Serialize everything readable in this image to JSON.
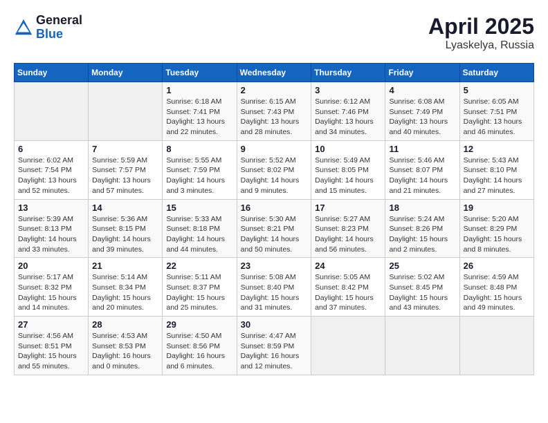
{
  "header": {
    "logo_general": "General",
    "logo_blue": "Blue",
    "month_year": "April 2025",
    "location": "Lyaskelya, Russia"
  },
  "weekdays": [
    "Sunday",
    "Monday",
    "Tuesday",
    "Wednesday",
    "Thursday",
    "Friday",
    "Saturday"
  ],
  "weeks": [
    [
      {
        "day": "",
        "info": ""
      },
      {
        "day": "",
        "info": ""
      },
      {
        "day": "1",
        "info": "Sunrise: 6:18 AM\nSunset: 7:41 PM\nDaylight: 13 hours and 22 minutes."
      },
      {
        "day": "2",
        "info": "Sunrise: 6:15 AM\nSunset: 7:43 PM\nDaylight: 13 hours and 28 minutes."
      },
      {
        "day": "3",
        "info": "Sunrise: 6:12 AM\nSunset: 7:46 PM\nDaylight: 13 hours and 34 minutes."
      },
      {
        "day": "4",
        "info": "Sunrise: 6:08 AM\nSunset: 7:49 PM\nDaylight: 13 hours and 40 minutes."
      },
      {
        "day": "5",
        "info": "Sunrise: 6:05 AM\nSunset: 7:51 PM\nDaylight: 13 hours and 46 minutes."
      }
    ],
    [
      {
        "day": "6",
        "info": "Sunrise: 6:02 AM\nSunset: 7:54 PM\nDaylight: 13 hours and 52 minutes."
      },
      {
        "day": "7",
        "info": "Sunrise: 5:59 AM\nSunset: 7:57 PM\nDaylight: 13 hours and 57 minutes."
      },
      {
        "day": "8",
        "info": "Sunrise: 5:55 AM\nSunset: 7:59 PM\nDaylight: 14 hours and 3 minutes."
      },
      {
        "day": "9",
        "info": "Sunrise: 5:52 AM\nSunset: 8:02 PM\nDaylight: 14 hours and 9 minutes."
      },
      {
        "day": "10",
        "info": "Sunrise: 5:49 AM\nSunset: 8:05 PM\nDaylight: 14 hours and 15 minutes."
      },
      {
        "day": "11",
        "info": "Sunrise: 5:46 AM\nSunset: 8:07 PM\nDaylight: 14 hours and 21 minutes."
      },
      {
        "day": "12",
        "info": "Sunrise: 5:43 AM\nSunset: 8:10 PM\nDaylight: 14 hours and 27 minutes."
      }
    ],
    [
      {
        "day": "13",
        "info": "Sunrise: 5:39 AM\nSunset: 8:13 PM\nDaylight: 14 hours and 33 minutes."
      },
      {
        "day": "14",
        "info": "Sunrise: 5:36 AM\nSunset: 8:15 PM\nDaylight: 14 hours and 39 minutes."
      },
      {
        "day": "15",
        "info": "Sunrise: 5:33 AM\nSunset: 8:18 PM\nDaylight: 14 hours and 44 minutes."
      },
      {
        "day": "16",
        "info": "Sunrise: 5:30 AM\nSunset: 8:21 PM\nDaylight: 14 hours and 50 minutes."
      },
      {
        "day": "17",
        "info": "Sunrise: 5:27 AM\nSunset: 8:23 PM\nDaylight: 14 hours and 56 minutes."
      },
      {
        "day": "18",
        "info": "Sunrise: 5:24 AM\nSunset: 8:26 PM\nDaylight: 15 hours and 2 minutes."
      },
      {
        "day": "19",
        "info": "Sunrise: 5:20 AM\nSunset: 8:29 PM\nDaylight: 15 hours and 8 minutes."
      }
    ],
    [
      {
        "day": "20",
        "info": "Sunrise: 5:17 AM\nSunset: 8:32 PM\nDaylight: 15 hours and 14 minutes."
      },
      {
        "day": "21",
        "info": "Sunrise: 5:14 AM\nSunset: 8:34 PM\nDaylight: 15 hours and 20 minutes."
      },
      {
        "day": "22",
        "info": "Sunrise: 5:11 AM\nSunset: 8:37 PM\nDaylight: 15 hours and 25 minutes."
      },
      {
        "day": "23",
        "info": "Sunrise: 5:08 AM\nSunset: 8:40 PM\nDaylight: 15 hours and 31 minutes."
      },
      {
        "day": "24",
        "info": "Sunrise: 5:05 AM\nSunset: 8:42 PM\nDaylight: 15 hours and 37 minutes."
      },
      {
        "day": "25",
        "info": "Sunrise: 5:02 AM\nSunset: 8:45 PM\nDaylight: 15 hours and 43 minutes."
      },
      {
        "day": "26",
        "info": "Sunrise: 4:59 AM\nSunset: 8:48 PM\nDaylight: 15 hours and 49 minutes."
      }
    ],
    [
      {
        "day": "27",
        "info": "Sunrise: 4:56 AM\nSunset: 8:51 PM\nDaylight: 15 hours and 55 minutes."
      },
      {
        "day": "28",
        "info": "Sunrise: 4:53 AM\nSunset: 8:53 PM\nDaylight: 16 hours and 0 minutes."
      },
      {
        "day": "29",
        "info": "Sunrise: 4:50 AM\nSunset: 8:56 PM\nDaylight: 16 hours and 6 minutes."
      },
      {
        "day": "30",
        "info": "Sunrise: 4:47 AM\nSunset: 8:59 PM\nDaylight: 16 hours and 12 minutes."
      },
      {
        "day": "",
        "info": ""
      },
      {
        "day": "",
        "info": ""
      },
      {
        "day": "",
        "info": ""
      }
    ]
  ]
}
